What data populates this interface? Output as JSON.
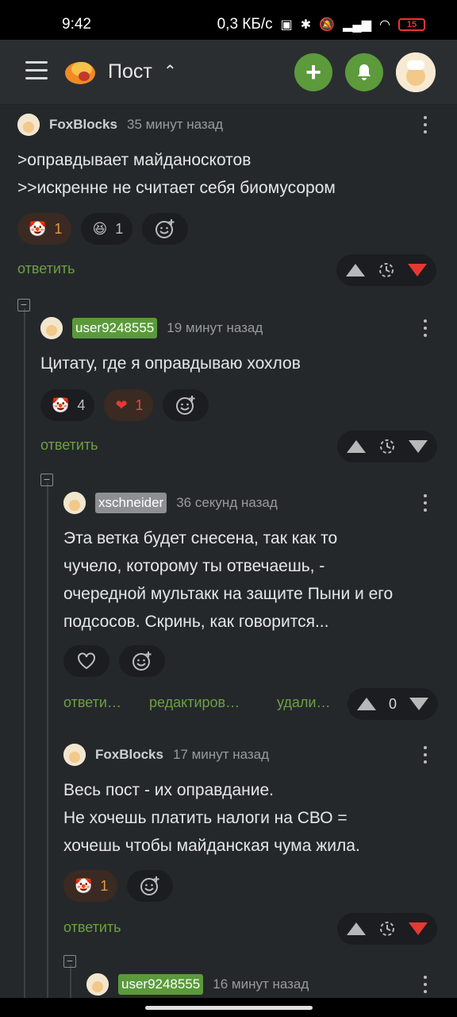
{
  "status_bar": {
    "time": "9:42",
    "speed": "0,3 КБ/с",
    "battery": "15"
  },
  "header": {
    "title": "Пост",
    "caret": "^"
  },
  "colors": {
    "accent_green": "#5c9a3c",
    "vote_down_red": "#e53935",
    "reply_link": "#6ca042",
    "background": "#25282b"
  },
  "icons": {
    "menu": "hamburger-icon",
    "add": "plus-icon",
    "notifications": "bell-icon",
    "more": "kebab-icon",
    "add_reaction": "smiley-plus-icon",
    "clown": "clown-emoji",
    "laugh": "laugh-emoji",
    "heart": "heart-icon",
    "save": "clock-save-icon"
  },
  "comments": [
    {
      "author": "FoxBlocks",
      "time": "35 минут назад",
      "text": ">оправдывает майданоскотов\n>>искренне не считает себя биомусором",
      "reactions": [
        {
          "emoji": "🤡",
          "count": "1"
        },
        {
          "emoji": "😆",
          "count": "1"
        }
      ],
      "reply": "ответить"
    },
    {
      "author": "user9248555",
      "time": "19 минут назад",
      "text": "Цитату, где я оправдываю хохлов",
      "reactions": [
        {
          "emoji": "🤡",
          "count": "4"
        },
        {
          "emoji": "❤",
          "count": "1"
        }
      ],
      "reply": "ответить"
    },
    {
      "author": "xschneider",
      "time": "36 секунд назад",
      "text": "Эта ветка будет снесена, так как то\nчучело, которому ты отвечаешь, -\nочередной мультакк на защите Пыни и его\nподсосов. Скринь, как говорится...",
      "reply": "ответи…",
      "edit": "редактиров…",
      "delete": "удали…",
      "score": "0"
    },
    {
      "author": "FoxBlocks",
      "time": "17 минут назад",
      "text": "Весь пост - их оправдание.\nНе хочешь платить налоги на СВО =\nхочешь чтобы майданская чума жила.",
      "reactions": [
        {
          "emoji": "🤡",
          "count": "1"
        }
      ],
      "reply": "ответить"
    },
    {
      "author": "user9248555",
      "time": "16 минут назад"
    }
  ]
}
